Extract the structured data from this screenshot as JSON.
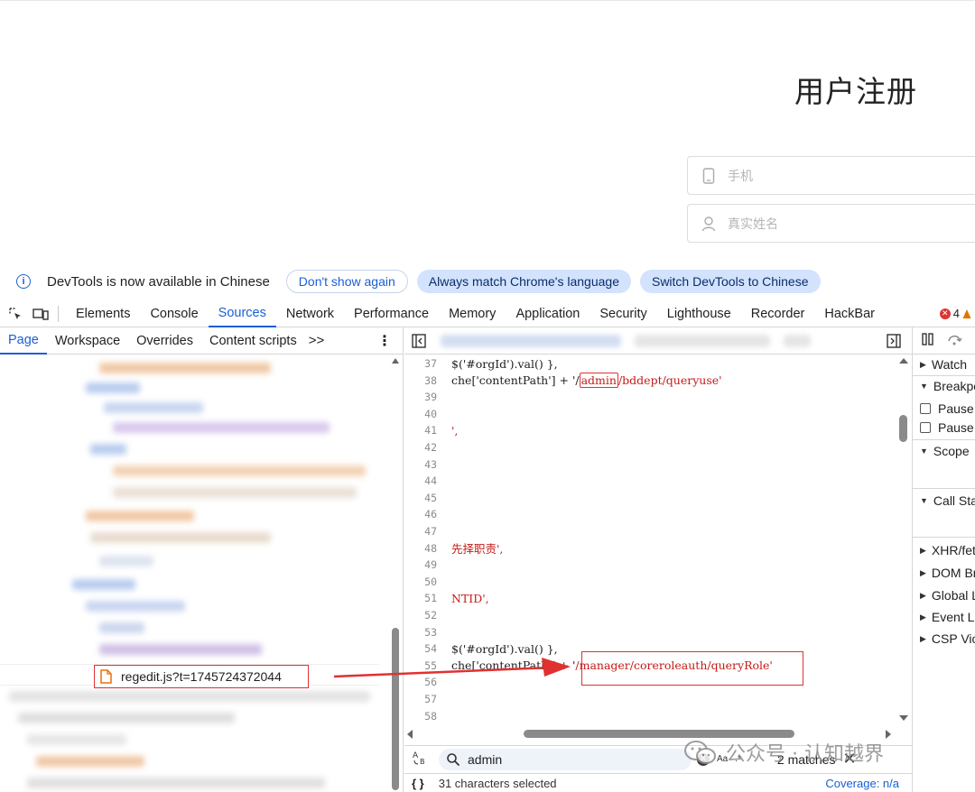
{
  "webpage": {
    "title": "用户注册",
    "fields": [
      {
        "placeholder": "手机",
        "icon": "phone-icon"
      },
      {
        "placeholder": "真实姓名",
        "icon": "user-icon"
      }
    ]
  },
  "banner": {
    "message": "DevTools is now available in Chinese",
    "dont_show": "Don't show again",
    "always_match": "Always match Chrome's language",
    "switch": "Switch DevTools to Chinese"
  },
  "devtools": {
    "tabs": [
      "Elements",
      "Console",
      "Sources",
      "Network",
      "Performance",
      "Memory",
      "Application",
      "Security",
      "Lighthouse",
      "Recorder",
      "HackBar"
    ],
    "active_tab": "Sources",
    "error_count": "4"
  },
  "navigator": {
    "tabs": [
      "Page",
      "Workspace",
      "Overrides",
      "Content scripts"
    ],
    "more": ">>",
    "selected_file": "regedit.js?t=1745724372044"
  },
  "editor": {
    "lines": [
      {
        "n": "37",
        "pre": "$('#orgId').val() },",
        "str": "",
        "post": ""
      },
      {
        "n": "38",
        "pre": "che['contentPath'] + '/",
        "str": "admin",
        "post": "/bddept/queryuse'"
      },
      {
        "n": "39",
        "pre": "",
        "str": "",
        "post": ""
      },
      {
        "n": "40",
        "pre": "",
        "str": "",
        "post": ""
      },
      {
        "n": "41",
        "pre": "',",
        "str": "",
        "post": ""
      },
      {
        "n": "42",
        "pre": "",
        "str": "",
        "post": ""
      },
      {
        "n": "43",
        "pre": "",
        "str": "",
        "post": ""
      },
      {
        "n": "44",
        "pre": "",
        "str": "",
        "post": ""
      },
      {
        "n": "45",
        "pre": "",
        "str": "",
        "post": ""
      },
      {
        "n": "46",
        "pre": "",
        "str": "",
        "post": ""
      },
      {
        "n": "47",
        "pre": "",
        "str": "",
        "post": ""
      },
      {
        "n": "48",
        "pre": "先择职责',",
        "str": "",
        "post": ""
      },
      {
        "n": "49",
        "pre": "",
        "str": "",
        "post": ""
      },
      {
        "n": "50",
        "pre": "",
        "str": "",
        "post": ""
      },
      {
        "n": "51",
        "pre": "NTID',",
        "str": "",
        "post": ""
      },
      {
        "n": "52",
        "pre": "",
        "str": "",
        "post": ""
      },
      {
        "n": "53",
        "pre": "",
        "str": "",
        "post": ""
      },
      {
        "n": "54",
        "pre": "$('#orgId').val() },",
        "str": "",
        "post": ""
      },
      {
        "n": "55",
        "pre": "che['contentPath'] + '",
        "str": "",
        "post": "/manager/coreroleauth/queryRole'"
      },
      {
        "n": "56",
        "pre": "",
        "str": "",
        "post": ""
      },
      {
        "n": "57",
        "pre": "",
        "str": "",
        "post": ""
      },
      {
        "n": "58",
        "pre": "",
        "str": "",
        "post": ""
      }
    ]
  },
  "search": {
    "query": "admin",
    "matches": "2 matches",
    "case_label": "Aa",
    "regex_label": ".*"
  },
  "status": {
    "selection": "31 characters selected",
    "coverage": "Coverage: n/a"
  },
  "debugger": {
    "items": [
      {
        "label": "Watch",
        "type": "section-collapsed"
      },
      {
        "label": "Breakpoints",
        "type": "section-expanded"
      },
      {
        "label": "Pause on uncaught exceptions",
        "type": "checkbox"
      },
      {
        "label": "Pause on caught exceptions",
        "type": "checkbox"
      },
      {
        "label": "Scope",
        "type": "section-expanded"
      },
      {
        "label": "Call Stack",
        "type": "section-expanded"
      },
      {
        "label": "XHR/fetch Breakpoints",
        "type": "section-collapsed"
      },
      {
        "label": "DOM Breakpoints",
        "type": "section-collapsed"
      },
      {
        "label": "Global Listeners",
        "type": "section-collapsed"
      },
      {
        "label": "Event Listener Breakpoints",
        "type": "section-collapsed"
      },
      {
        "label": "CSP Violation Breakpoints",
        "type": "section-collapsed"
      }
    ]
  },
  "watermark": {
    "text": "公众号 · 认知越界"
  },
  "colors": {
    "accent": "#1a5fd6",
    "annotation_red": "#e03131",
    "string_red": "#c41a16"
  }
}
